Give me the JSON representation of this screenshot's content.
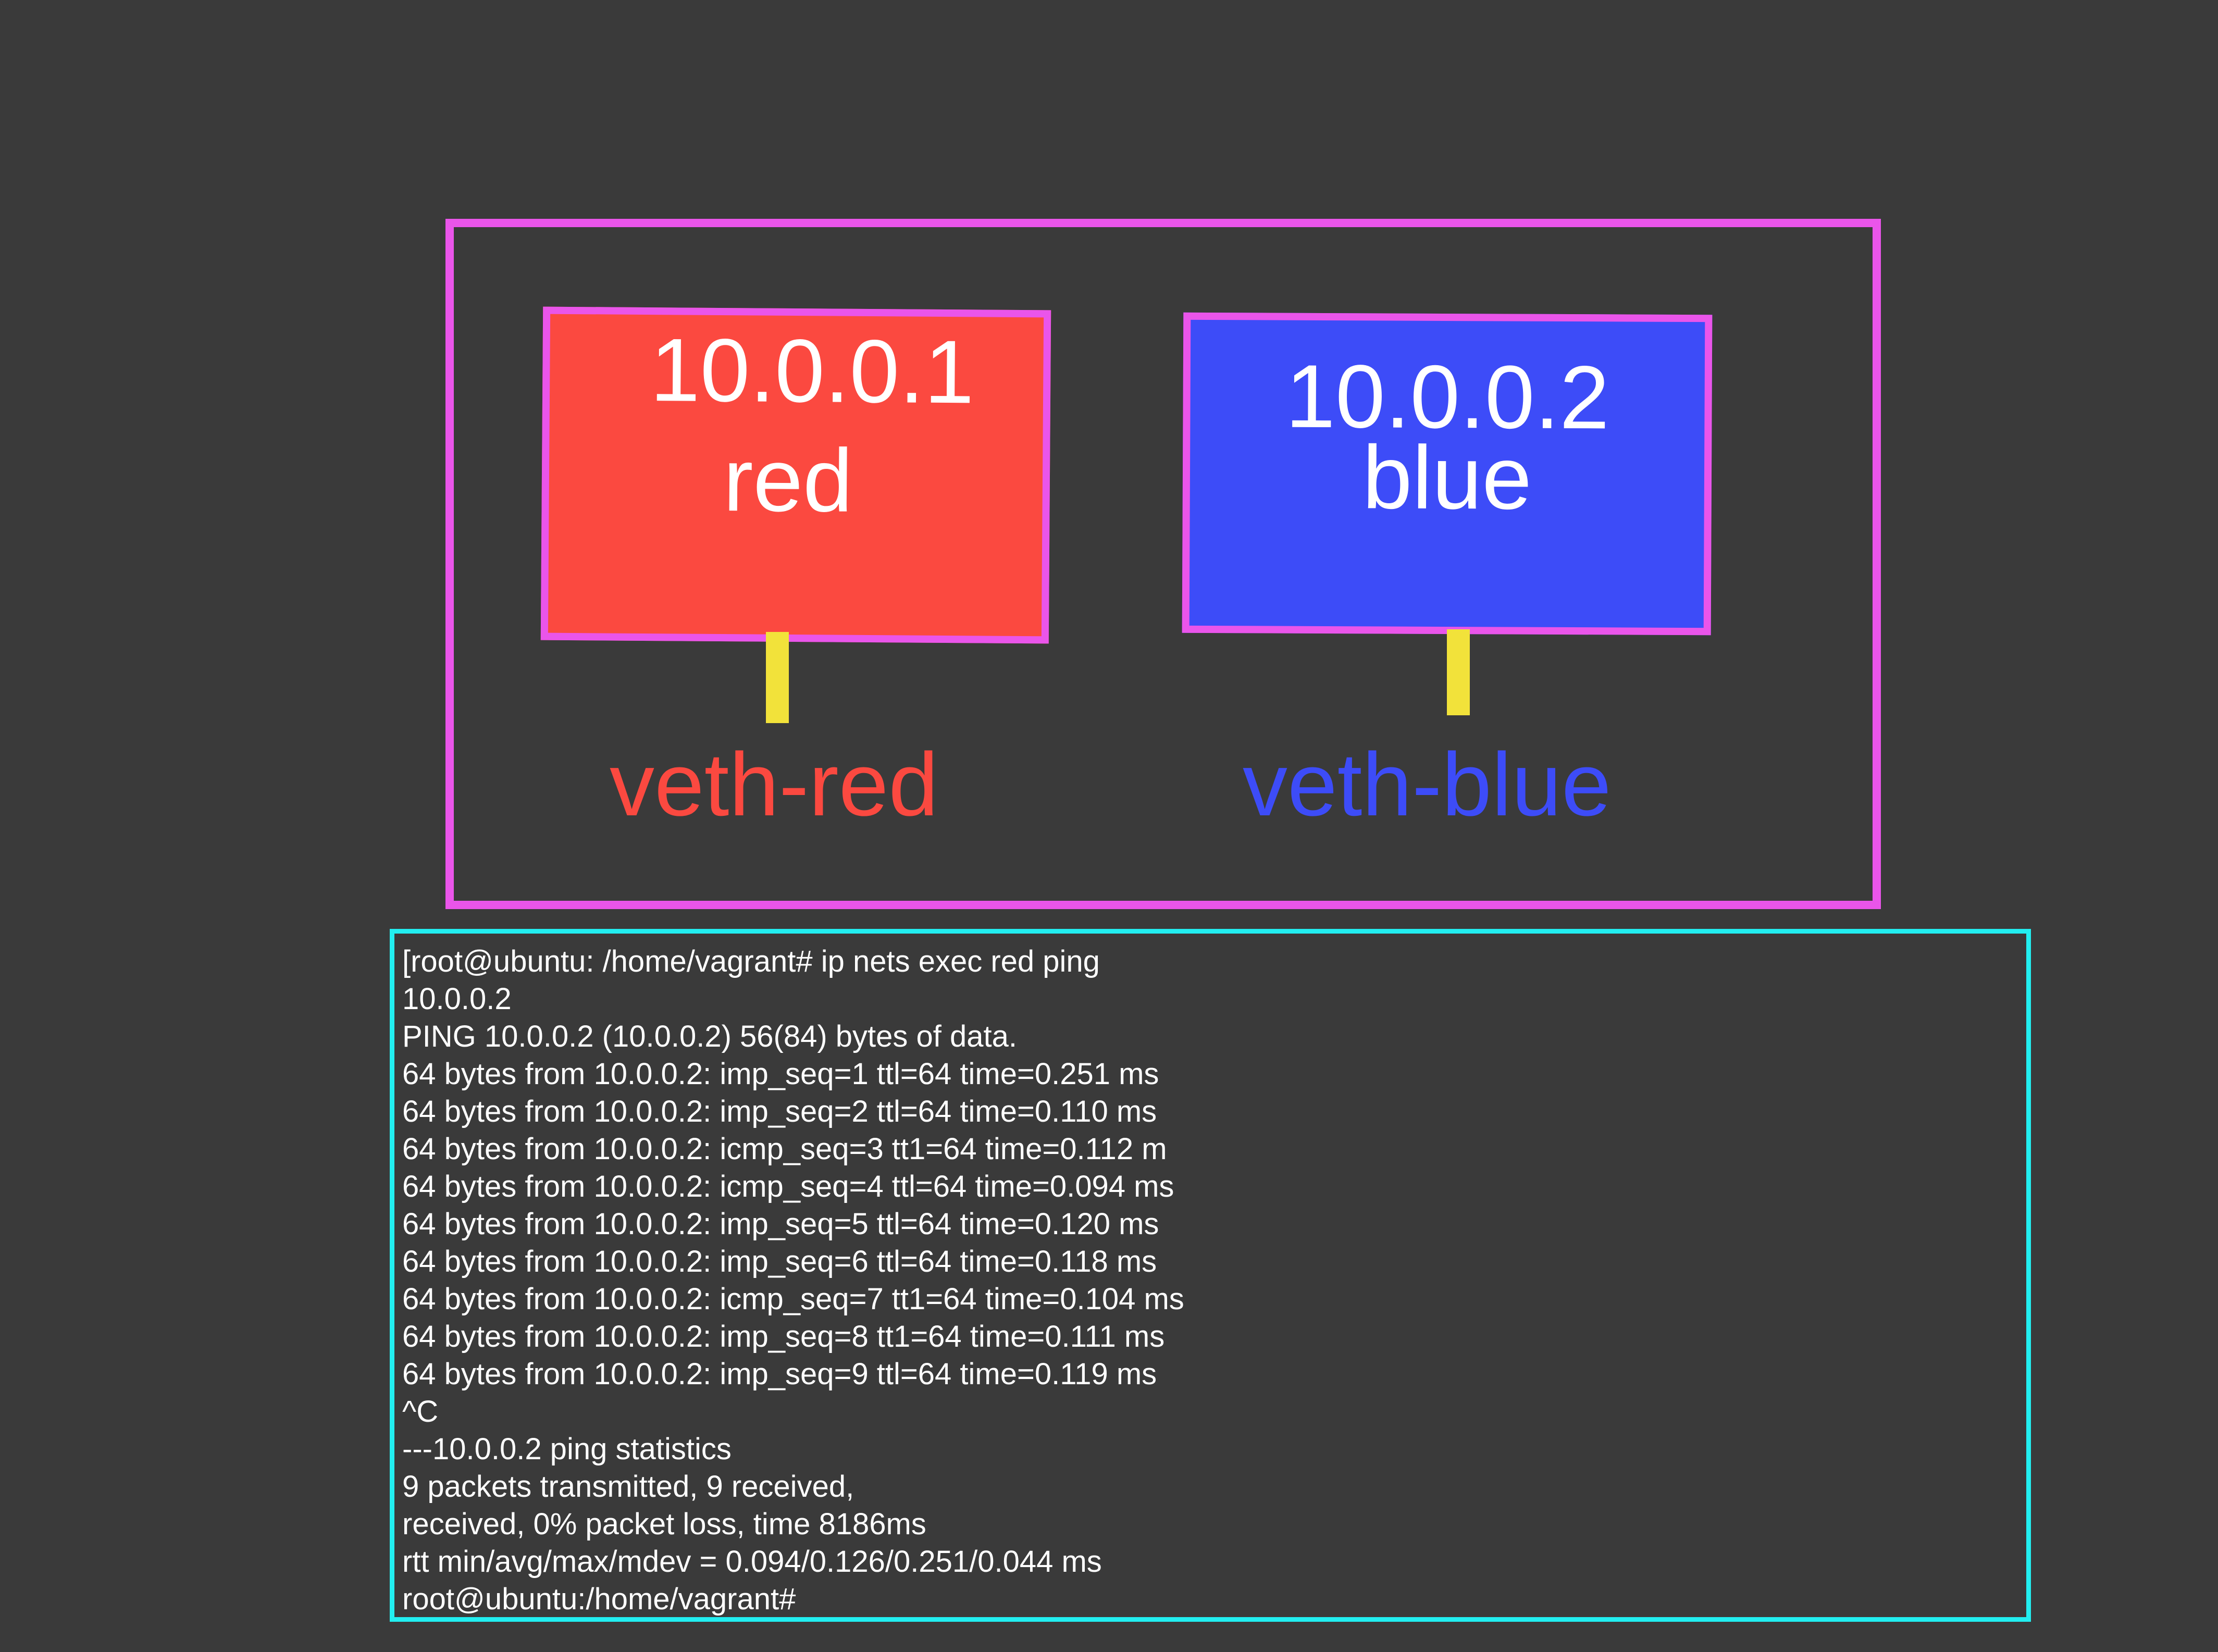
{
  "namespaces": [
    {
      "ip": "10.0.0.1",
      "name": "red",
      "color": "#fb4940",
      "interface": "veth-red"
    },
    {
      "ip": "10.0.0.2",
      "name": "blue",
      "color": "#3d4cf8",
      "interface": "veth-blue"
    }
  ],
  "colors": {
    "background": "#3a3a3a",
    "host_border": "#ea55ea",
    "link": "#f2e23a",
    "terminal_border": "#22eef0",
    "text": "#ffffff"
  },
  "terminal": {
    "lines": [
      "[root@ubuntu: /home/vagrant# ip nets exec red ping",
      "10.0.0.2",
      "PING 10.0.0.2 (10.0.0.2) 56(84) bytes of data.",
      "64 bytes from 10.0.0.2: imp_seq=1 ttl=64 time=0.251 ms",
      "64 bytes from 10.0.0.2: imp_seq=2 ttl=64 time=0.110 ms",
      "64 bytes from 10.0.0.2: icmp_seq=3 tt1=64 time=0.112 m",
      "64 bytes from 10.0.0.2: icmp_seq=4 ttl=64 time=0.094 ms",
      "64 bytes from 10.0.0.2: imp_seq=5 ttl=64 time=0.120 ms",
      "64 bytes from 10.0.0.2: imp_seq=6 ttl=64 time=0.118 ms",
      "64 bytes from 10.0.0.2: icmp_seq=7 tt1=64 time=0.104 ms",
      "64 bytes from 10.0.0.2: imp_seq=8 tt1=64 time=0.111 ms",
      "64 bytes from 10.0.0.2: imp_seq=9 ttl=64 time=0.119 ms",
      "^C",
      "---10.0.0.2 ping statistics",
      "9 packets transmitted, 9 received,",
      "received, 0% packet loss, time 8186ms",
      "rtt min/avg/max/mdev = 0.094/0.126/0.251/0.044 ms",
      "root@ubuntu:/home/vagrant#"
    ]
  }
}
